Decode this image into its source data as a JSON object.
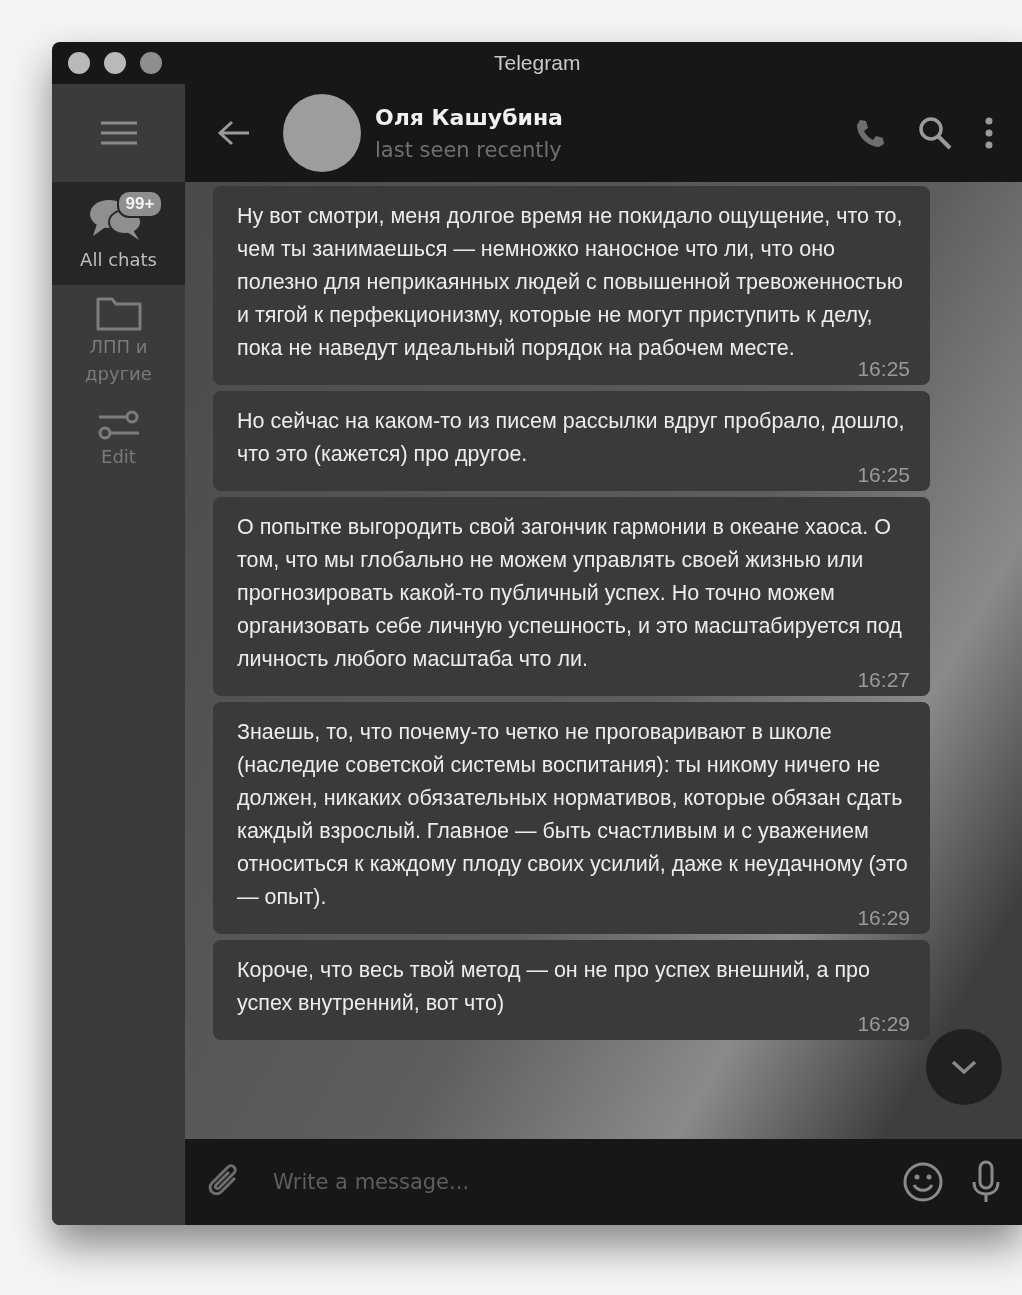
{
  "window": {
    "title": "Telegram"
  },
  "sidebar": {
    "folders": [
      {
        "kind": "chats",
        "label": "All chats",
        "badge": "99+",
        "selected": true
      },
      {
        "kind": "folder",
        "label": "ЛПП и другие",
        "selected": false
      },
      {
        "kind": "edit",
        "label": "Edit",
        "selected": false
      }
    ]
  },
  "chat_header": {
    "name": "Оля Кашубина",
    "status": "last seen recently"
  },
  "messages": [
    {
      "text": "Ну вот смотри, меня долгое время не покидало ощущение, что то, чем ты занимаешься — немножко наносное что ли, что оно полезно для неприкаянных людей с повышенной тревоженностью и тягой к перфекционизму, которые не могут приступить к делу, пока не наведут идеальный порядок на рабочем месте.",
      "time": "16:25"
    },
    {
      "text": "Но сейчас на каком-то из писем рассылки вдруг пробрало, дошло, что это (кажется) про другое.",
      "time": "16:25"
    },
    {
      "text": "О попытке выгородить свой загончик гармонии в океане хаоса. О том, что мы глобально не можем управлять своей жизнью или прогнозировать какой-то публичный успех. Но точно можем организовать себе личную успешность, и это масштабируется под личность любого масштаба что ли.",
      "time": "16:27"
    },
    {
      "text": "Знаешь, то, что почему-то четко не проговаривают в школе (наследие советской системы воспитания): ты никому ничего не должен, никаких обязательных нормативов, которые обязан сдать каждый взрослый. Главное — быть счастливым и с уважением относиться к каждому плоду своих усилий, даже к неудачному (это — опыт).",
      "time": "16:29"
    },
    {
      "text": "Короче, что весь твой метод — он не про успех внешний, а про успех внутренний, вот что)",
      "time": "16:29"
    }
  ],
  "composer": {
    "placeholder": "Write a message..."
  }
}
